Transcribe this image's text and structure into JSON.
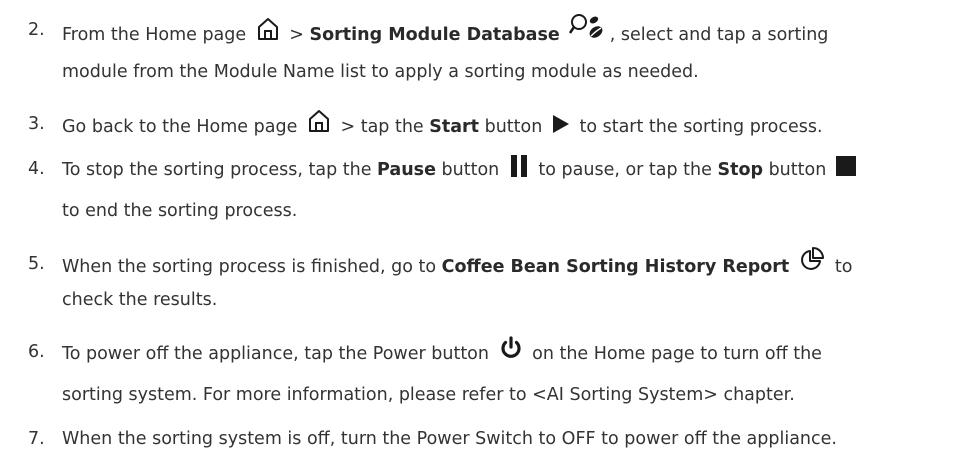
{
  "steps": [
    {
      "num": "2.",
      "l1_a": "From the Home page ",
      "l1_b": " > ",
      "l1_bold": "Sorting Module Database",
      "l1_c": ", select and tap a sorting",
      "l2": "module from the Module Name list to apply a sorting module as needed."
    },
    {
      "num": "3.",
      "l1_a": "Go back to the Home page ",
      "l1_b": " > tap the ",
      "l1_bold": "Start",
      "l1_c": " button ",
      "l1_d": " to start the sorting process."
    },
    {
      "num": "4.",
      "l1_a": "To stop the sorting process, tap the ",
      "l1_bold1": "Pause",
      "l1_b": " button ",
      "l1_c": " to pause, or tap the ",
      "l1_bold2": "Stop",
      "l1_d": " button ",
      "l2": "to end the sorting process."
    },
    {
      "num": "5.",
      "l1_a": "When the sorting process is finished, go to ",
      "l1_bold": "Coffee Bean Sorting History Report",
      "l1_b": " to",
      "l2": "check the results."
    },
    {
      "num": "6.",
      "l1_a": "To power off the appliance, tap the Power button ",
      "l1_b": " on the Home page to turn off the",
      "l2": "sorting system. For more information, please refer to <AI Sorting System> chapter."
    },
    {
      "num": "7.",
      "l1": "When the sorting system is off, turn the Power Switch to OFF to power off the appliance."
    }
  ],
  "icons": {
    "home": "home-icon",
    "sorting_module": "coffee-bean-search-icon",
    "start": "play-icon",
    "pause": "pause-icon",
    "stop": "stop-icon",
    "history": "pie-chart-icon",
    "power": "power-icon"
  },
  "colors": {
    "text": "#333333",
    "icon": "#1a1a1a"
  }
}
